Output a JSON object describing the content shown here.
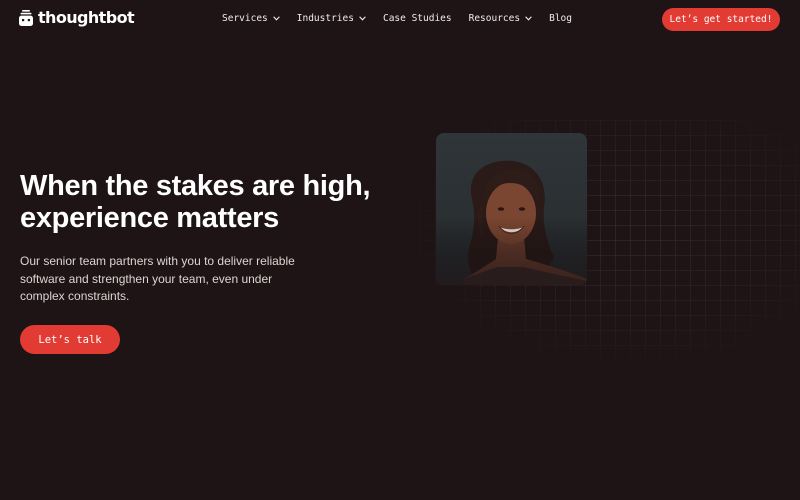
{
  "brand": {
    "name": "thoughtbot",
    "logo_icon": "robot-icon"
  },
  "nav": {
    "items": [
      {
        "label": "Services",
        "has_dropdown": true
      },
      {
        "label": "Industries",
        "has_dropdown": true
      },
      {
        "label": "Case Studies",
        "has_dropdown": false
      },
      {
        "label": "Resources",
        "has_dropdown": true
      },
      {
        "label": "Blog",
        "has_dropdown": false
      }
    ]
  },
  "header_cta": {
    "label": "Let’s get started!"
  },
  "hero": {
    "headline": {
      "line1": "When the stakes are high,",
      "line2": "experience matters"
    },
    "subtext": {
      "line1": "Our senior team partners with you to deliver reliable",
      "line2": "software and strengthen your team, even under",
      "line3": "complex constraints."
    },
    "cta_label": "Let’s talk"
  },
  "colors": {
    "background": "#1e1416",
    "accent": "#e13b33",
    "text": "#ffffff",
    "muted_text": "#ddd5d2",
    "photo_card": "#2b3033"
  }
}
